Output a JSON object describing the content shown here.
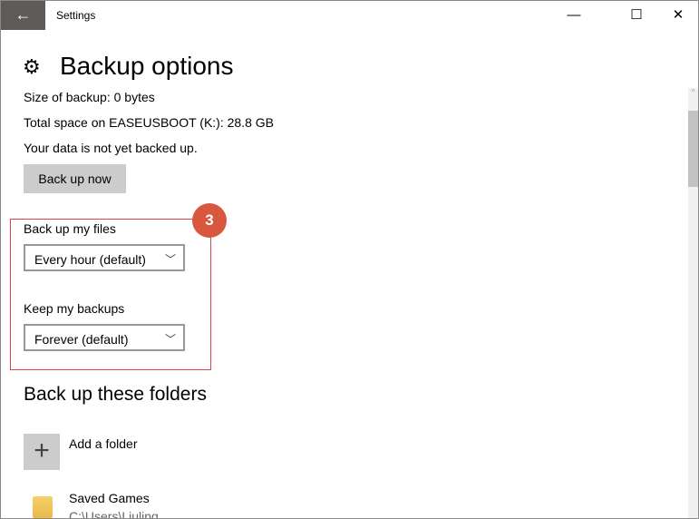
{
  "window": {
    "title": "Settings",
    "back": "←",
    "minimize": "—",
    "maximize": "☐",
    "close": "✕"
  },
  "page": {
    "title": "Backup options",
    "icon": "gear-icon"
  },
  "info": {
    "size": "Size of backup: 0 bytes",
    "space": "Total space on EASEUSBOOT (K:): 28.8 GB",
    "status": "Your data is not yet backed up."
  },
  "back_up_now": "Back up now",
  "frequency": {
    "label": "Back up my files",
    "value": "Every hour (default)"
  },
  "retention": {
    "label": "Keep my backups",
    "value": "Forever (default)"
  },
  "callout": {
    "number": "3",
    "color": "#d9573f",
    "box_color": "#e0444c"
  },
  "folders": {
    "heading": "Back up these folders",
    "add": "Add a folder",
    "items": [
      {
        "name": "Saved Games",
        "path": "C:\\Users\\Liuling"
      }
    ]
  }
}
